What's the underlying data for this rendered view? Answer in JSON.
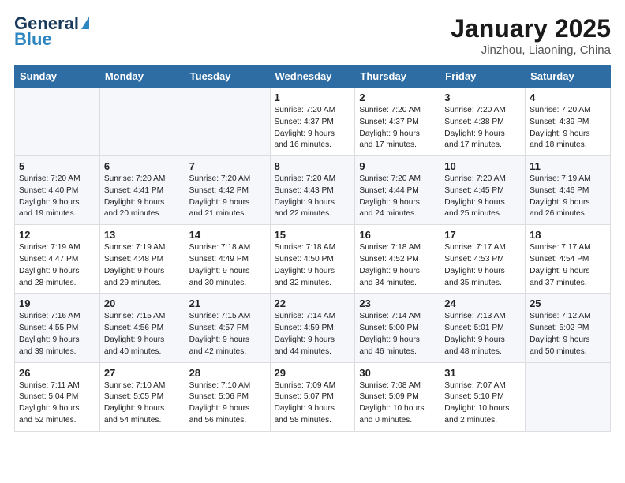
{
  "header": {
    "logo_line1": "General",
    "logo_line2": "Blue",
    "title": "January 2025",
    "subtitle": "Jinzhou, Liaoning, China"
  },
  "days_of_week": [
    "Sunday",
    "Monday",
    "Tuesday",
    "Wednesday",
    "Thursday",
    "Friday",
    "Saturday"
  ],
  "weeks": [
    [
      {
        "day": "",
        "info": ""
      },
      {
        "day": "",
        "info": ""
      },
      {
        "day": "",
        "info": ""
      },
      {
        "day": "1",
        "info": "Sunrise: 7:20 AM\nSunset: 4:37 PM\nDaylight: 9 hours\nand 16 minutes."
      },
      {
        "day": "2",
        "info": "Sunrise: 7:20 AM\nSunset: 4:37 PM\nDaylight: 9 hours\nand 17 minutes."
      },
      {
        "day": "3",
        "info": "Sunrise: 7:20 AM\nSunset: 4:38 PM\nDaylight: 9 hours\nand 17 minutes."
      },
      {
        "day": "4",
        "info": "Sunrise: 7:20 AM\nSunset: 4:39 PM\nDaylight: 9 hours\nand 18 minutes."
      }
    ],
    [
      {
        "day": "5",
        "info": "Sunrise: 7:20 AM\nSunset: 4:40 PM\nDaylight: 9 hours\nand 19 minutes."
      },
      {
        "day": "6",
        "info": "Sunrise: 7:20 AM\nSunset: 4:41 PM\nDaylight: 9 hours\nand 20 minutes."
      },
      {
        "day": "7",
        "info": "Sunrise: 7:20 AM\nSunset: 4:42 PM\nDaylight: 9 hours\nand 21 minutes."
      },
      {
        "day": "8",
        "info": "Sunrise: 7:20 AM\nSunset: 4:43 PM\nDaylight: 9 hours\nand 22 minutes."
      },
      {
        "day": "9",
        "info": "Sunrise: 7:20 AM\nSunset: 4:44 PM\nDaylight: 9 hours\nand 24 minutes."
      },
      {
        "day": "10",
        "info": "Sunrise: 7:20 AM\nSunset: 4:45 PM\nDaylight: 9 hours\nand 25 minutes."
      },
      {
        "day": "11",
        "info": "Sunrise: 7:19 AM\nSunset: 4:46 PM\nDaylight: 9 hours\nand 26 minutes."
      }
    ],
    [
      {
        "day": "12",
        "info": "Sunrise: 7:19 AM\nSunset: 4:47 PM\nDaylight: 9 hours\nand 28 minutes."
      },
      {
        "day": "13",
        "info": "Sunrise: 7:19 AM\nSunset: 4:48 PM\nDaylight: 9 hours\nand 29 minutes."
      },
      {
        "day": "14",
        "info": "Sunrise: 7:18 AM\nSunset: 4:49 PM\nDaylight: 9 hours\nand 30 minutes."
      },
      {
        "day": "15",
        "info": "Sunrise: 7:18 AM\nSunset: 4:50 PM\nDaylight: 9 hours\nand 32 minutes."
      },
      {
        "day": "16",
        "info": "Sunrise: 7:18 AM\nSunset: 4:52 PM\nDaylight: 9 hours\nand 34 minutes."
      },
      {
        "day": "17",
        "info": "Sunrise: 7:17 AM\nSunset: 4:53 PM\nDaylight: 9 hours\nand 35 minutes."
      },
      {
        "day": "18",
        "info": "Sunrise: 7:17 AM\nSunset: 4:54 PM\nDaylight: 9 hours\nand 37 minutes."
      }
    ],
    [
      {
        "day": "19",
        "info": "Sunrise: 7:16 AM\nSunset: 4:55 PM\nDaylight: 9 hours\nand 39 minutes."
      },
      {
        "day": "20",
        "info": "Sunrise: 7:15 AM\nSunset: 4:56 PM\nDaylight: 9 hours\nand 40 minutes."
      },
      {
        "day": "21",
        "info": "Sunrise: 7:15 AM\nSunset: 4:57 PM\nDaylight: 9 hours\nand 42 minutes."
      },
      {
        "day": "22",
        "info": "Sunrise: 7:14 AM\nSunset: 4:59 PM\nDaylight: 9 hours\nand 44 minutes."
      },
      {
        "day": "23",
        "info": "Sunrise: 7:14 AM\nSunset: 5:00 PM\nDaylight: 9 hours\nand 46 minutes."
      },
      {
        "day": "24",
        "info": "Sunrise: 7:13 AM\nSunset: 5:01 PM\nDaylight: 9 hours\nand 48 minutes."
      },
      {
        "day": "25",
        "info": "Sunrise: 7:12 AM\nSunset: 5:02 PM\nDaylight: 9 hours\nand 50 minutes."
      }
    ],
    [
      {
        "day": "26",
        "info": "Sunrise: 7:11 AM\nSunset: 5:04 PM\nDaylight: 9 hours\nand 52 minutes."
      },
      {
        "day": "27",
        "info": "Sunrise: 7:10 AM\nSunset: 5:05 PM\nDaylight: 9 hours\nand 54 minutes."
      },
      {
        "day": "28",
        "info": "Sunrise: 7:10 AM\nSunset: 5:06 PM\nDaylight: 9 hours\nand 56 minutes."
      },
      {
        "day": "29",
        "info": "Sunrise: 7:09 AM\nSunset: 5:07 PM\nDaylight: 9 hours\nand 58 minutes."
      },
      {
        "day": "30",
        "info": "Sunrise: 7:08 AM\nSunset: 5:09 PM\nDaylight: 10 hours\nand 0 minutes."
      },
      {
        "day": "31",
        "info": "Sunrise: 7:07 AM\nSunset: 5:10 PM\nDaylight: 10 hours\nand 2 minutes."
      },
      {
        "day": "",
        "info": ""
      }
    ]
  ]
}
